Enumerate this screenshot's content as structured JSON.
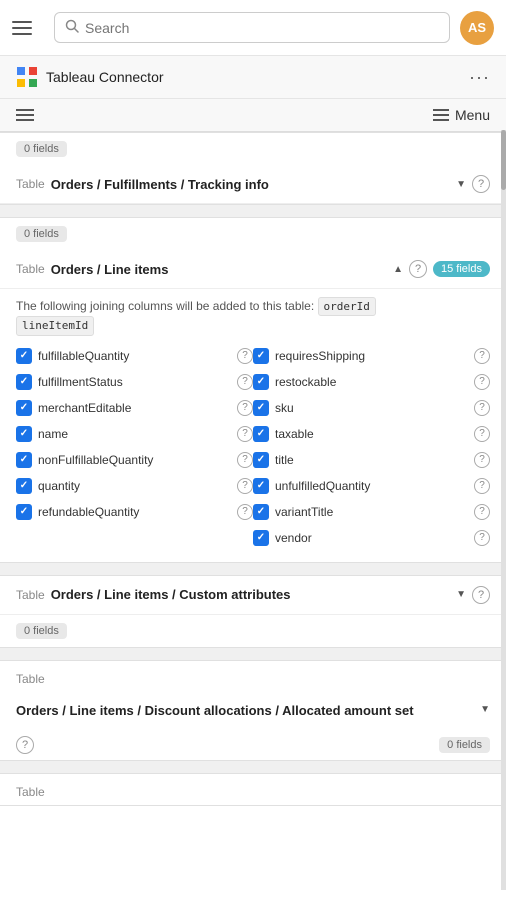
{
  "topBar": {
    "searchPlaceholder": "Search",
    "avatarInitials": "AS",
    "hamburgerLabel": "menu"
  },
  "secondBar": {
    "title": "Tableau Connector",
    "dotsLabel": "more options"
  },
  "subHeader": {
    "menuLabel": "Menu"
  },
  "sections": [
    {
      "id": "section-fulfillments-tracking",
      "fieldsCount": "0 fields",
      "tableName": "Orders / Fulfillments / Tracking info",
      "hasChevron": true,
      "chevronDir": "down",
      "hasHelp": true,
      "showFields": false
    },
    {
      "id": "section-line-items",
      "fieldsCount": "0 fields",
      "tableName": "Orders / Line items",
      "hasChevron": true,
      "chevronDir": "up",
      "hasHelp": false,
      "fieldsCountBadge": "15 fields",
      "joiningText": "The following joining columns will be added to this table:",
      "joiningTags": [
        "orderId",
        "lineItemId"
      ],
      "showFields": true,
      "leftFields": [
        {
          "name": "fulfillableQuantity",
          "checked": true
        },
        {
          "name": "fulfillmentStatus",
          "checked": true
        },
        {
          "name": "merchantEditable",
          "checked": true
        },
        {
          "name": "name",
          "checked": true
        },
        {
          "name": "nonFulfillableQuantity",
          "checked": true
        },
        {
          "name": "quantity",
          "checked": true
        },
        {
          "name": "refundableQuantity",
          "checked": true
        }
      ],
      "rightFields": [
        {
          "name": "requiresShipping",
          "checked": true
        },
        {
          "name": "restockable",
          "checked": true
        },
        {
          "name": "sku",
          "checked": true
        },
        {
          "name": "taxable",
          "checked": true
        },
        {
          "name": "title",
          "checked": true
        },
        {
          "name": "unfulfilledQuantity",
          "checked": true
        },
        {
          "name": "variantTitle",
          "checked": true
        },
        {
          "name": "vendor",
          "checked": true
        }
      ]
    },
    {
      "id": "section-line-items-custom",
      "fieldsCount": "0 fields",
      "tableName": "Orders / Line items / Custom attributes",
      "hasChevron": true,
      "chevronDir": "down",
      "hasHelp": true,
      "showFields": false
    },
    {
      "id": "section-discount-allocations",
      "tableLabel": "Table",
      "tableName": "Orders / Line items / Discount allocations / Allocated amount set",
      "hasChevron": true,
      "chevronDir": "down",
      "fieldsCount": "0 fields",
      "hasHelp": true,
      "showFields": false
    }
  ],
  "lastTableLabel": "Table"
}
